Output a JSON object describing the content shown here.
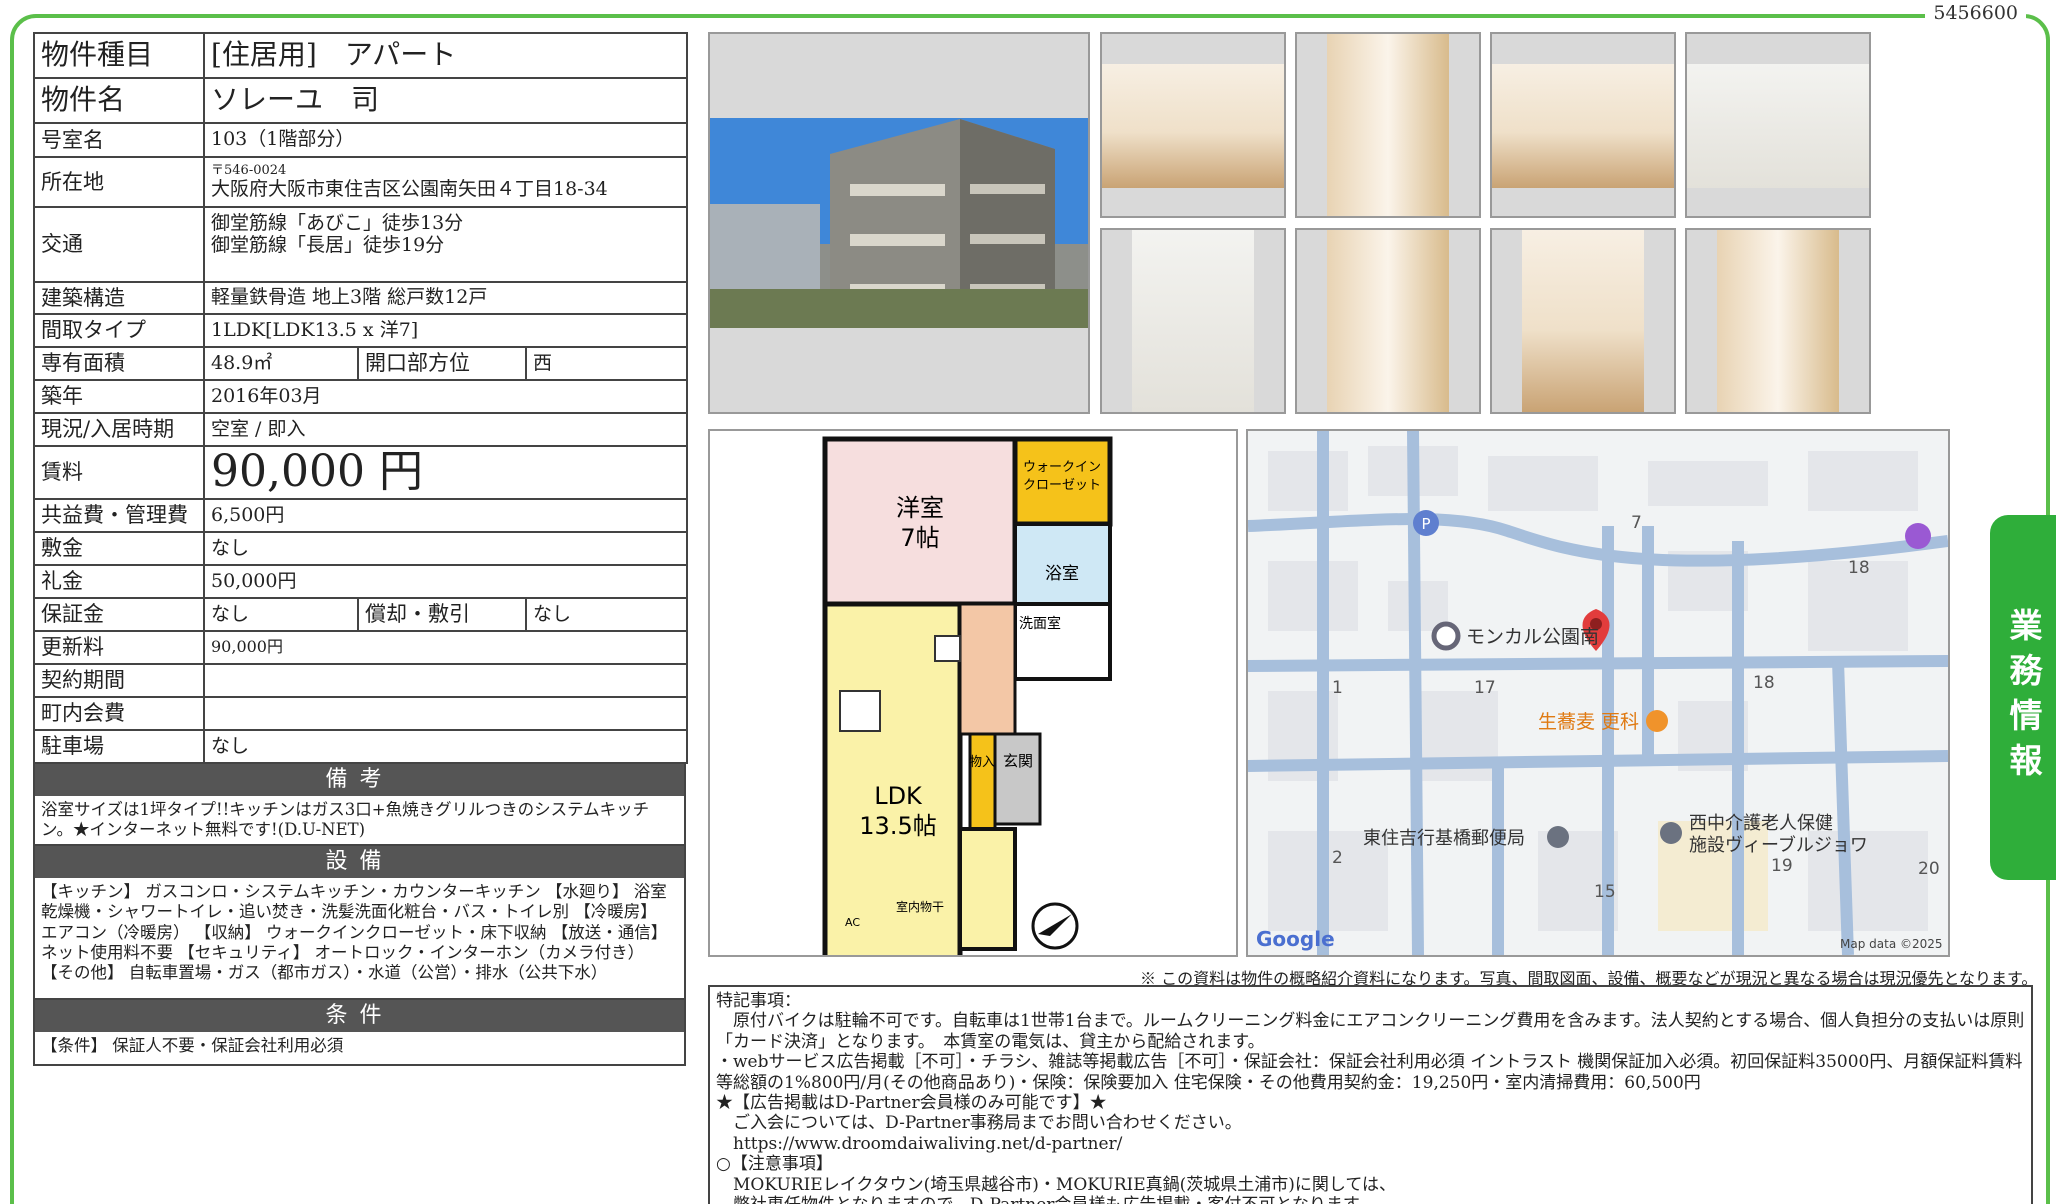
{
  "doc_id": "5456600",
  "side_tab": "業務情報",
  "spec": {
    "type_label": "物件種目",
    "type_value": "[住居用]　アパート",
    "name_label": "物件名",
    "name_value": "ソレーユ　司",
    "room_label": "号室名",
    "room_value": "103（1階部分）",
    "address_label": "所在地",
    "zip": "〒546-0024",
    "address_value": "大阪府大阪市東住吉区公園南矢田４丁目18-34",
    "access_label": "交通",
    "access_1": "御堂筋線「あびこ」徒歩13分",
    "access_2": "御堂筋線「長居」徒歩19分",
    "structure_label": "建築構造",
    "structure_value": "軽量鉄骨造 地上3階 総戸数12戸",
    "layout_label": "間取タイプ",
    "layout_value": "1LDK[LDK13.5 x 洋7]",
    "area_label": "専有面積",
    "area_value": "48.9㎡",
    "facing_label": "開口部方位",
    "facing_value": "西",
    "built_label": "築年",
    "built_value": "2016年03月",
    "status_label": "現況/入居時期",
    "status_value": "空室 / 即入",
    "rent_label": "賃料",
    "rent_value": "90,000 円",
    "fee_label": "共益費・管理費",
    "fee_value": "6,500円",
    "deposit_label": "敷金",
    "deposit_value": "なし",
    "key_label": "礼金",
    "key_value": "50,000円",
    "guarantee_label": "保証金",
    "guarantee_value": "なし",
    "amort_label": "償却・敷引",
    "amort_value": "なし",
    "renewal_label": "更新料",
    "renewal_value": "90,000円",
    "contract_label": "契約期間",
    "contract_value": "",
    "town_label": "町内会費",
    "town_value": "",
    "parking_label": "駐車場",
    "parking_value": "なし"
  },
  "remarks": {
    "head": "備考",
    "body": "浴室サイズは1坪タイプ!!キッチンはガス3口+魚焼きグリルつきのシステムキッチン。★インターネット無料です!(D.U-NET)"
  },
  "equipment": {
    "head": "設備",
    "body": "【キッチン】 ガスコンロ・システムキッチン・カウンターキッチン 【水廻り】 浴室乾燥機・シャワートイレ・追い焚き・洗髪洗面化粧台・バス・トイレ別 【冷暖房】 エアコン（冷暖房） 【収納】 ウォークインクローゼット・床下収納 【放送・通信】 ネット使用料不要 【セキュリティ】 オートロック・インターホン（カメラ付き） 【その他】 自転車置場・ガス（都市ガス）・水道（公営）・排水（公共下水）"
  },
  "conditions": {
    "head": "条件",
    "body": "【条件】 保証人不要・保証会社利用必須"
  },
  "floorplan": {
    "western": "洋室",
    "western_size": "7帖",
    "wic": "ウォークイン",
    "wic2": "クローゼット",
    "bath": "浴室",
    "washroom": "洗面室",
    "storage": "物入",
    "entrance": "玄関",
    "ldk": "LDK",
    "ldk_size": "13.5帖",
    "indoor_dry": "室内物干",
    "ac": "AC"
  },
  "map": {
    "park": "モンカル公園南",
    "soba": "生蕎麦 更科",
    "post": "東住吉行基橋郵便局",
    "care_1": "西中介護老人保健",
    "care_2": "施設ヴィーブルジョワ",
    "n7": "7",
    "n18a": "18",
    "n1": "1",
    "n17": "17",
    "n18b": "18",
    "n2": "2",
    "n15": "15",
    "n19": "19",
    "n20": "20",
    "google": "Google",
    "credit": "Map data ©2025"
  },
  "disclaimer": "※ この資料は物件の概略紹介資料になります。写真、間取図面、設備、概要などが現況と異なる場合は現況優先となります。",
  "notes": {
    "l1": "特記事項：",
    "l2": "　原付バイクは駐輪不可です。自転車は1世帯1台まで。ルームクリーニング料金にエアコンクリーニング費用を含みます。法人契約とする場合、個人負担分の支払いは原則「カード決済」となります。　本賃室の電気は、貸主から配給されます。",
    "l3": "・webサービス広告掲載［不可］・チラシ、雑誌等掲載広告［不可］・保証会社：保証会社利用必須 イントラスト 機関保証加入必須。初回保証料35000円、月額保証料賃料等総額の1%800円/月(その他商品あり)・保険：保険要加入 住宅保険・その他費用契約金：19,250円・室内清掃費用：60,500円",
    "l4": "★【広告掲載はD-Partner会員様のみ可能です】★",
    "l5": "　ご入会については、D-Partner事務局までお問い合わせください。",
    "l6": "　https://www.droomdaiwaliving.net/d-partner/",
    "l7": "○【注意事項】",
    "l8": "　MOKURIEレイクタウン(埼玉県越谷市)・MOKURIE真鍋(茨城県土浦市)に関しては、",
    "l9": "　弊社専任物件となりますので、D-Partner会員様も広告掲載・客付不可となります。"
  },
  "colors": {
    "frame": "#5bbf4a",
    "tab": "#2fae3a",
    "section": "#555555"
  }
}
